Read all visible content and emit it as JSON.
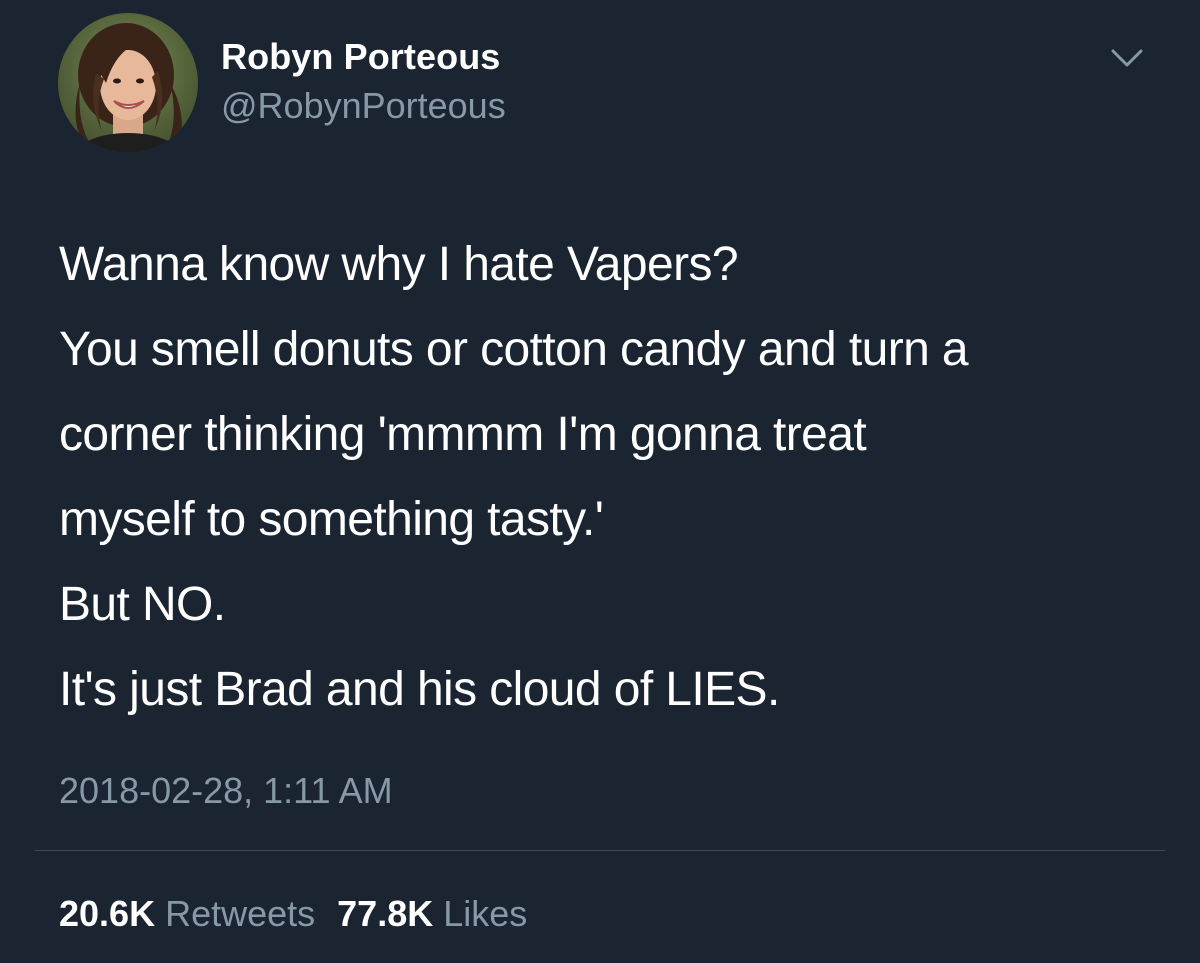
{
  "author": {
    "display_name": "Robyn Porteous",
    "handle": "@RobynPorteous",
    "avatar_icon": "profile-photo"
  },
  "menu": {
    "icon": "chevron-down-icon"
  },
  "tweet": {
    "lines": [
      "Wanna know why I hate Vapers?",
      "You smell donuts or cotton candy and turn a",
      "corner thinking 'mmmm I'm gonna treat",
      "myself to something tasty.'",
      "But NO.",
      "It's just Brad and his cloud of LIES."
    ],
    "timestamp": "2018-02-28, 1:11 AM"
  },
  "stats": {
    "retweets_count": "20.6K",
    "retweets_label": "Retweets",
    "likes_count": "77.8K",
    "likes_label": "Likes"
  },
  "colors": {
    "background": "#1b2431",
    "primary_text": "#ffffff",
    "secondary_text": "#8899a6",
    "divider": "#3d4a58"
  }
}
